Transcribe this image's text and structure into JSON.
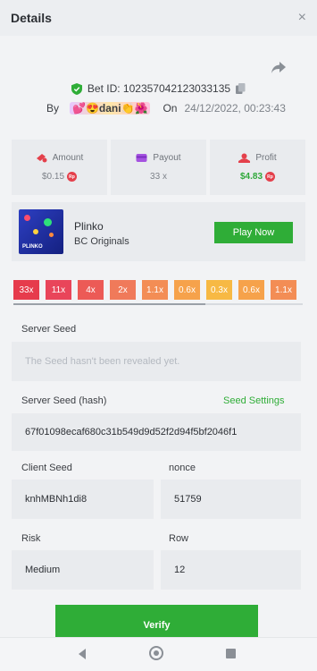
{
  "header": {
    "title": "Details",
    "close": "×"
  },
  "bet": {
    "id_label": "Bet ID: 102357042123033135",
    "by": "By",
    "user": "💕😍dani👏🌺",
    "on": "On",
    "datetime": "24/12/2022, 00:23:43"
  },
  "stats": [
    {
      "label": "Amount",
      "value": "$0.15",
      "coin": true,
      "green": false
    },
    {
      "label": "Payout",
      "value": "33 x",
      "coin": false,
      "green": false
    },
    {
      "label": "Profit",
      "value": "$4.83",
      "coin": true,
      "green": true
    }
  ],
  "game": {
    "name": "Plinko",
    "subtitle": "BC Originals",
    "thumb_text": "PLINKO",
    "play_label": "Play Now"
  },
  "multipliers": [
    {
      "label": "33x",
      "color": "#e63b4c"
    },
    {
      "label": "11x",
      "color": "#e9455a"
    },
    {
      "label": "4x",
      "color": "#ec5a56"
    },
    {
      "label": "2x",
      "color": "#f07a5a"
    },
    {
      "label": "1.1x",
      "color": "#f38d55"
    },
    {
      "label": "0.6x",
      "color": "#f6a24b"
    },
    {
      "label": "0.3x",
      "color": "#f7b944"
    },
    {
      "label": "0.6x",
      "color": "#f6a24b"
    },
    {
      "label": "1.1x",
      "color": "#f38d55"
    }
  ],
  "server_seed": {
    "label": "Server Seed",
    "placeholder": "The Seed hasn't been revealed yet."
  },
  "server_seed_hash": {
    "label": "Server Seed (hash)",
    "settings_link": "Seed Settings",
    "value": "67f01098ecaf680c31b549d9d52f2d94f5bf2046f1"
  },
  "client_seed": {
    "label": "Client Seed",
    "value": "knhMBNh1di8"
  },
  "nonce": {
    "label": "nonce",
    "value": "51759"
  },
  "risk": {
    "label": "Risk",
    "value": "Medium"
  },
  "row": {
    "label": "Row",
    "value": "12"
  },
  "verify_label": "Verify",
  "colors": {
    "accent_green": "#2fad37",
    "coin_red": "#e4404b"
  }
}
